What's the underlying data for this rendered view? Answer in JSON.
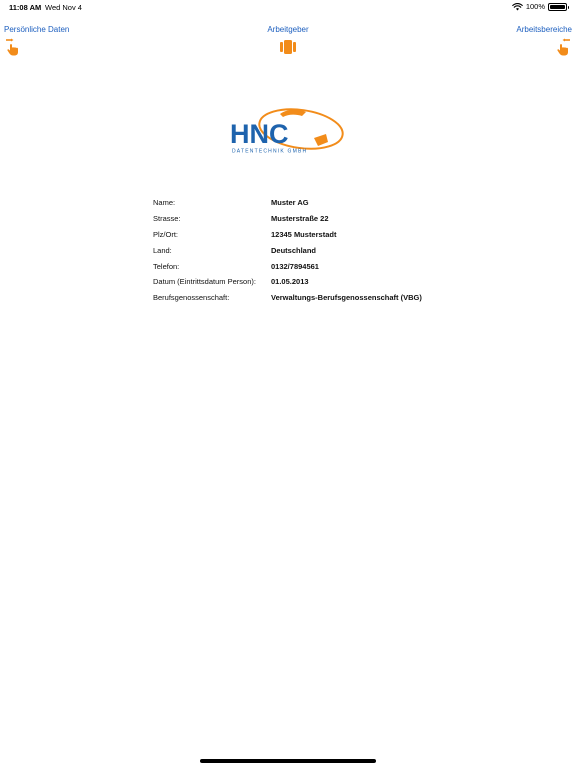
{
  "status_bar": {
    "time": "11:08 AM",
    "date": "Wed Nov 4",
    "battery": "100%"
  },
  "nav": {
    "left_label": "Persönliche Daten",
    "center_label": "Arbeitgeber",
    "right_label": "Arbeitsbereiche",
    "accent_color": "#f28c1a",
    "link_color": "#1d5fbf"
  },
  "logo": {
    "text": "HNC",
    "subtitle": "DATENTECHNIK GMBH",
    "primary_color": "#1e63ad",
    "secondary_color": "#f28c1a"
  },
  "employer": {
    "rows": [
      {
        "label": "Name:",
        "value": "Muster AG"
      },
      {
        "label": "Strasse:",
        "value": "Musterstraße 22"
      },
      {
        "label": "Plz/Ort:",
        "value": "12345 Musterstadt"
      },
      {
        "label": "Land:",
        "value": "Deutschland"
      },
      {
        "label": "Telefon:",
        "value": "0132/7894561"
      },
      {
        "label": "Datum (Eintrittsdatum Person):",
        "value": "01.05.2013"
      },
      {
        "label": "Berufsgenossenschaft:",
        "value": "Verwaltungs-Berufsgenossenschaft (VBG)"
      }
    ]
  }
}
